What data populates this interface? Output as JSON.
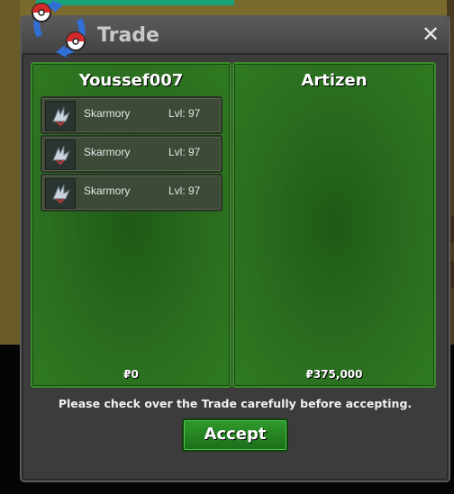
{
  "window": {
    "title": "Trade",
    "close_symbol": "✕"
  },
  "left_panel": {
    "player": "Youssef007",
    "items": [
      {
        "name": "Skarmory",
        "level": "Lvl: 97",
        "icon": "skarmory-sprite-icon"
      },
      {
        "name": "Skarmory",
        "level": "Lvl: 97",
        "icon": "skarmory-sprite-icon"
      },
      {
        "name": "Skarmory",
        "level": "Lvl: 97",
        "icon": "skarmory-sprite-icon"
      }
    ],
    "money": "₽0"
  },
  "right_panel": {
    "player": "Artizen",
    "items": [],
    "money": "₽375,000"
  },
  "notice": "Please check over the Trade carefully before accepting.",
  "accept_label": "Accept",
  "colors": {
    "panel_green": "#2a6e1f",
    "accept_green": "#2f9a2c",
    "window_bg": "#3c3c3c"
  }
}
